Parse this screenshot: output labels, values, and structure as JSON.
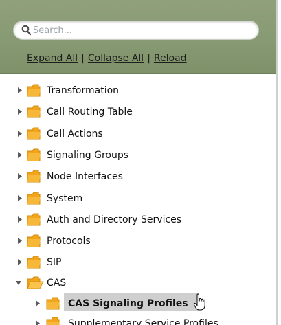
{
  "search": {
    "placeholder": "Search..."
  },
  "toolbar": {
    "expand_all": "Expand All",
    "separator": "|",
    "collapse_all": "Collapse All",
    "reload": "Reload"
  },
  "tree": {
    "items": [
      {
        "label": "Transformation",
        "expanded": false
      },
      {
        "label": "Call Routing Table",
        "expanded": false
      },
      {
        "label": "Call Actions",
        "expanded": false
      },
      {
        "label": "Signaling Groups",
        "expanded": false
      },
      {
        "label": "Node Interfaces",
        "expanded": false
      },
      {
        "label": "System",
        "expanded": false
      },
      {
        "label": "Auth and Directory Services",
        "expanded": false
      },
      {
        "label": "Protocols",
        "expanded": false
      },
      {
        "label": "SIP",
        "expanded": false
      },
      {
        "label": "CAS",
        "expanded": true,
        "children": [
          {
            "label": "CAS Signaling Profiles",
            "selected": true
          },
          {
            "label": "Supplementary Service Profiles"
          }
        ]
      }
    ]
  },
  "colors": {
    "header_bg": "#889a73",
    "folder": "#f2a51a",
    "selected_bg": "#cfcfcf"
  }
}
